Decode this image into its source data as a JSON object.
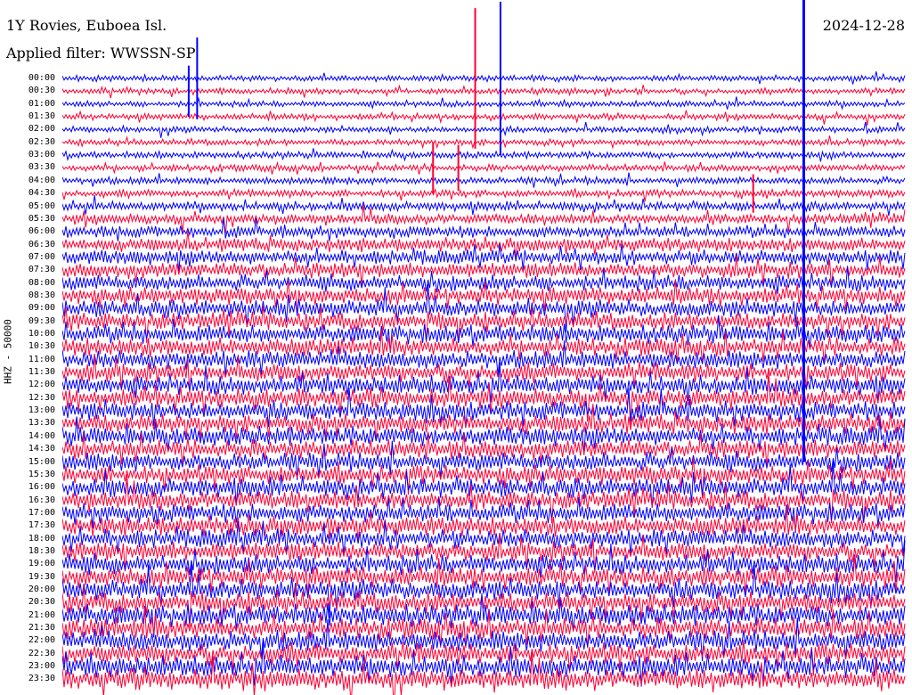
{
  "header": {
    "station": "1Y Rovies, Euboea Isl.",
    "filter": "Applied filter: WWSSN-SP",
    "date": "2024-12-28"
  },
  "chart_data": {
    "type": "line",
    "title": "1Y Rovies, Euboea Isl.",
    "subtitle": "Applied filter: WWSSN-SP",
    "date": "2024-12-28",
    "ylabel": "HHZ - 50000",
    "row_labels": [
      "00:00",
      "00:30",
      "01:00",
      "01:30",
      "02:00",
      "02:30",
      "03:00",
      "03:30",
      "04:00",
      "04:30",
      "05:00",
      "05:30",
      "06:00",
      "06:30",
      "07:00",
      "07:30",
      "08:00",
      "08:30",
      "09:00",
      "09:30",
      "10:00",
      "10:30",
      "11:00",
      "11:30",
      "12:00",
      "12:30",
      "13:00",
      "13:30",
      "14:00",
      "14:30",
      "15:00",
      "15:30",
      "16:00",
      "16:30",
      "17:00",
      "17:30",
      "18:00",
      "18:30",
      "19:00",
      "19:30",
      "20:00",
      "20:30",
      "21:00",
      "21:30",
      "22:00",
      "22:30",
      "23:00",
      "23:30"
    ],
    "row_noise_level": [
      0.12,
      0.12,
      0.12,
      0.13,
      0.13,
      0.14,
      0.16,
      0.18,
      0.2,
      0.22,
      0.3,
      0.38,
      0.45,
      0.55,
      0.62,
      0.68,
      0.72,
      0.75,
      0.78,
      0.8,
      0.82,
      0.84,
      0.85,
      0.86,
      0.87,
      0.88,
      0.88,
      0.88,
      0.88,
      0.88,
      0.88,
      0.88,
      0.88,
      0.88,
      0.88,
      0.88,
      0.88,
      0.9,
      0.92,
      0.94,
      0.96,
      0.98,
      1.0,
      1.0,
      1.0,
      1.0,
      1.0,
      1.0
    ],
    "series_colors": [
      "#0000ff",
      "#ff0033"
    ],
    "events": [
      {
        "time": "00:00",
        "x_fraction": 0.16,
        "amplitude": 3.2,
        "color": "#0000ff"
      },
      {
        "time": "00:30",
        "x_fraction": 0.15,
        "amplitude": 2.0,
        "color": "#0000ff"
      },
      {
        "time": "00:00",
        "x_fraction": 0.49,
        "amplitude": 5.5,
        "color": "#ff0033"
      },
      {
        "time": "00:00",
        "x_fraction": 0.52,
        "amplitude": 6.0,
        "color": "#0000ff"
      },
      {
        "time": "00:00",
        "x_fraction": 0.88,
        "amplitude": 30.0,
        "color": "#0000ff"
      },
      {
        "time": "03:30",
        "x_fraction": 0.44,
        "amplitude": 2.0,
        "color": "#ff0033"
      },
      {
        "time": "03:30",
        "x_fraction": 0.47,
        "amplitude": 1.8,
        "color": "#ff0033"
      },
      {
        "time": "04:30",
        "x_fraction": 0.82,
        "amplitude": 1.5,
        "color": "#ff0033"
      }
    ],
    "grid": false
  }
}
